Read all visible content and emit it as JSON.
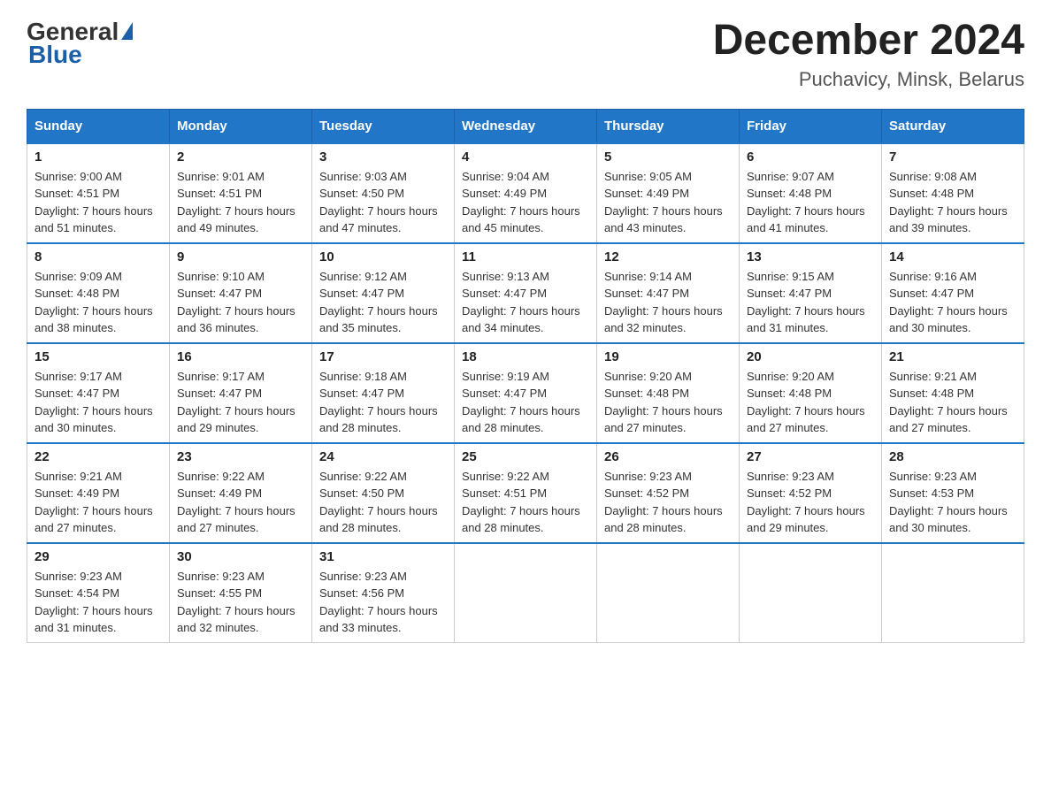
{
  "header": {
    "logo_general": "General",
    "logo_blue": "Blue",
    "month_year": "December 2024",
    "location": "Puchavicy, Minsk, Belarus"
  },
  "weekdays": [
    "Sunday",
    "Monday",
    "Tuesday",
    "Wednesday",
    "Thursday",
    "Friday",
    "Saturday"
  ],
  "weeks": [
    [
      {
        "day": "1",
        "sunrise": "9:00 AM",
        "sunset": "4:51 PM",
        "daylight": "7 hours and 51 minutes."
      },
      {
        "day": "2",
        "sunrise": "9:01 AM",
        "sunset": "4:51 PM",
        "daylight": "7 hours and 49 minutes."
      },
      {
        "day": "3",
        "sunrise": "9:03 AM",
        "sunset": "4:50 PM",
        "daylight": "7 hours and 47 minutes."
      },
      {
        "day": "4",
        "sunrise": "9:04 AM",
        "sunset": "4:49 PM",
        "daylight": "7 hours and 45 minutes."
      },
      {
        "day": "5",
        "sunrise": "9:05 AM",
        "sunset": "4:49 PM",
        "daylight": "7 hours and 43 minutes."
      },
      {
        "day": "6",
        "sunrise": "9:07 AM",
        "sunset": "4:48 PM",
        "daylight": "7 hours and 41 minutes."
      },
      {
        "day": "7",
        "sunrise": "9:08 AM",
        "sunset": "4:48 PM",
        "daylight": "7 hours and 39 minutes."
      }
    ],
    [
      {
        "day": "8",
        "sunrise": "9:09 AM",
        "sunset": "4:48 PM",
        "daylight": "7 hours and 38 minutes."
      },
      {
        "day": "9",
        "sunrise": "9:10 AM",
        "sunset": "4:47 PM",
        "daylight": "7 hours and 36 minutes."
      },
      {
        "day": "10",
        "sunrise": "9:12 AM",
        "sunset": "4:47 PM",
        "daylight": "7 hours and 35 minutes."
      },
      {
        "day": "11",
        "sunrise": "9:13 AM",
        "sunset": "4:47 PM",
        "daylight": "7 hours and 34 minutes."
      },
      {
        "day": "12",
        "sunrise": "9:14 AM",
        "sunset": "4:47 PM",
        "daylight": "7 hours and 32 minutes."
      },
      {
        "day": "13",
        "sunrise": "9:15 AM",
        "sunset": "4:47 PM",
        "daylight": "7 hours and 31 minutes."
      },
      {
        "day": "14",
        "sunrise": "9:16 AM",
        "sunset": "4:47 PM",
        "daylight": "7 hours and 30 minutes."
      }
    ],
    [
      {
        "day": "15",
        "sunrise": "9:17 AM",
        "sunset": "4:47 PM",
        "daylight": "7 hours and 30 minutes."
      },
      {
        "day": "16",
        "sunrise": "9:17 AM",
        "sunset": "4:47 PM",
        "daylight": "7 hours and 29 minutes."
      },
      {
        "day": "17",
        "sunrise": "9:18 AM",
        "sunset": "4:47 PM",
        "daylight": "7 hours and 28 minutes."
      },
      {
        "day": "18",
        "sunrise": "9:19 AM",
        "sunset": "4:47 PM",
        "daylight": "7 hours and 28 minutes."
      },
      {
        "day": "19",
        "sunrise": "9:20 AM",
        "sunset": "4:48 PM",
        "daylight": "7 hours and 27 minutes."
      },
      {
        "day": "20",
        "sunrise": "9:20 AM",
        "sunset": "4:48 PM",
        "daylight": "7 hours and 27 minutes."
      },
      {
        "day": "21",
        "sunrise": "9:21 AM",
        "sunset": "4:48 PM",
        "daylight": "7 hours and 27 minutes."
      }
    ],
    [
      {
        "day": "22",
        "sunrise": "9:21 AM",
        "sunset": "4:49 PM",
        "daylight": "7 hours and 27 minutes."
      },
      {
        "day": "23",
        "sunrise": "9:22 AM",
        "sunset": "4:49 PM",
        "daylight": "7 hours and 27 minutes."
      },
      {
        "day": "24",
        "sunrise": "9:22 AM",
        "sunset": "4:50 PM",
        "daylight": "7 hours and 28 minutes."
      },
      {
        "day": "25",
        "sunrise": "9:22 AM",
        "sunset": "4:51 PM",
        "daylight": "7 hours and 28 minutes."
      },
      {
        "day": "26",
        "sunrise": "9:23 AM",
        "sunset": "4:52 PM",
        "daylight": "7 hours and 28 minutes."
      },
      {
        "day": "27",
        "sunrise": "9:23 AM",
        "sunset": "4:52 PM",
        "daylight": "7 hours and 29 minutes."
      },
      {
        "day": "28",
        "sunrise": "9:23 AM",
        "sunset": "4:53 PM",
        "daylight": "7 hours and 30 minutes."
      }
    ],
    [
      {
        "day": "29",
        "sunrise": "9:23 AM",
        "sunset": "4:54 PM",
        "daylight": "7 hours and 31 minutes."
      },
      {
        "day": "30",
        "sunrise": "9:23 AM",
        "sunset": "4:55 PM",
        "daylight": "7 hours and 32 minutes."
      },
      {
        "day": "31",
        "sunrise": "9:23 AM",
        "sunset": "4:56 PM",
        "daylight": "7 hours and 33 minutes."
      },
      null,
      null,
      null,
      null
    ]
  ]
}
